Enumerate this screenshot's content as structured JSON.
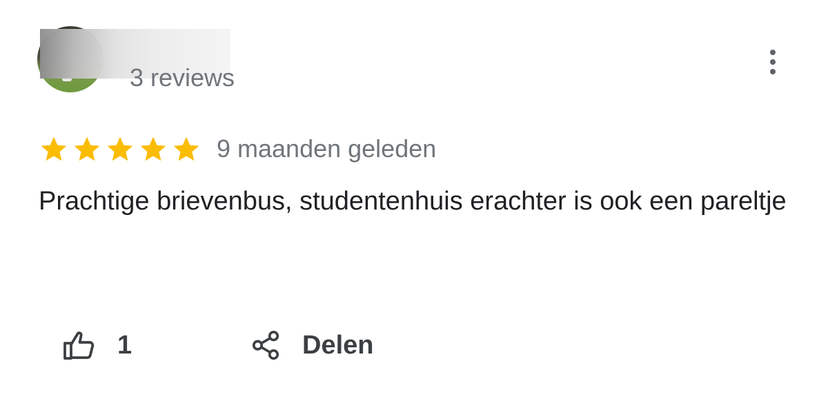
{
  "reviewer": {
    "name_obscured": true,
    "reviews_count": "3 reviews",
    "avatar_icon": "reviewer-avatar"
  },
  "menu": {
    "icon": "more-vertical-icon"
  },
  "review": {
    "rating": 5,
    "rating_max": 5,
    "star_color": "#fbbc04",
    "date": "9 maanden geleden",
    "text": "Prachtige brievenbus, studentenhuis erachter is ook een pareltje"
  },
  "actions": {
    "like_icon": "thumbs-up-icon",
    "like_count": "1",
    "share_icon": "share-icon",
    "share_label": "Delen"
  }
}
